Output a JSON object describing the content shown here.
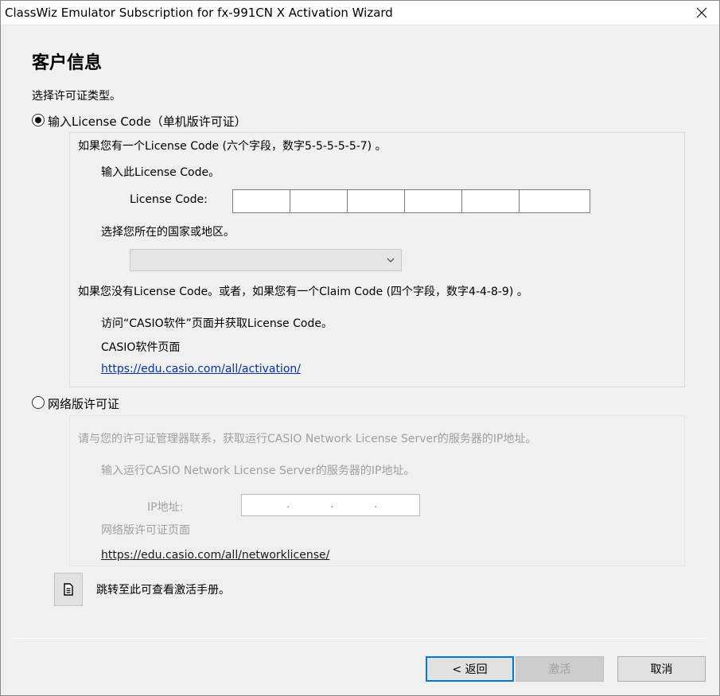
{
  "window": {
    "title": "ClassWiz Emulator Subscription for fx-991CN X Activation Wizard"
  },
  "page": {
    "heading": "客户信息",
    "prompt": "选择许可证类型。"
  },
  "standalone": {
    "radio_label": "输入License Code（单机版许可证）",
    "selected": true,
    "intro": "如果您有一个License Code (六个字段，数字5-5-5-5-5-7) 。",
    "enter_prompt": "输入此License Code。",
    "code_label": "License Code:",
    "code_fields": [
      "",
      "",
      "",
      "",
      "",
      ""
    ],
    "country_prompt": "选择您所在的国家或地区。",
    "country_value": "",
    "no_code_text": "如果您没有License Code。或者，如果您有一个Claim Code (四个字段，数字4-4-8-9) 。",
    "visit_text": "访问“CASIO软件”页面并获取License Code。",
    "software_page_label": "CASIO软件页面",
    "activation_url": "https://edu.casio.com/all/activation/"
  },
  "network": {
    "radio_label": "网络版许可证",
    "selected": false,
    "contact_text": "请与您的许可证管理器联系，获取运行CASIO Network License Server的服务器的IP地址。",
    "enter_prompt": "输入运行CASIO Network License Server的服务器的IP地址。",
    "ip_label": "IP地址:",
    "ip_separators": [
      ".",
      ".",
      "."
    ],
    "page_label": "网络版许可证页面",
    "license_url": "https://edu.casio.com/all/networklicense/"
  },
  "manual": {
    "text": "跳转至此可查看激活手册。",
    "icon": "document-icon"
  },
  "buttons": {
    "back": "< 返回",
    "activate": "激活",
    "cancel": "取消"
  }
}
